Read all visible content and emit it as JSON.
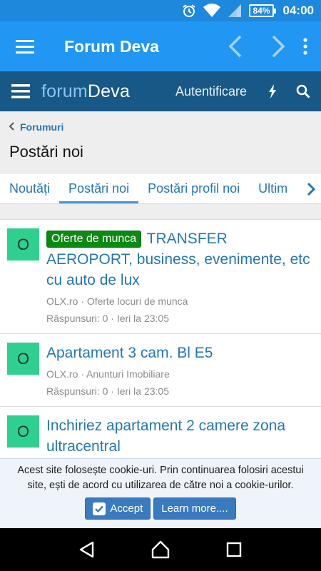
{
  "status_bar": {
    "battery": "84%",
    "time": "04:00"
  },
  "app_bar": {
    "title": "Forum Deva"
  },
  "forum_header": {
    "logo_part1": "forum",
    "logo_part2": "Deva",
    "login": "Autentificare"
  },
  "breadcrumb": {
    "label": "Forumuri"
  },
  "page": {
    "title": "Postări noi"
  },
  "tabs": [
    {
      "label": "Noutăți"
    },
    {
      "label": "Postări noi"
    },
    {
      "label": "Postări profil noi"
    },
    {
      "label": "Ultim"
    }
  ],
  "threads": [
    {
      "avatar": "O",
      "prefix": "Oferte de munca",
      "title": "TRANSFER AEROPORT, business, evenimente, etc cu auto de lux",
      "author": "OLX.ro",
      "forum": "Oferte locuri de munca",
      "replies": "Răspunsuri: 0",
      "date": "Ieri la 23:05"
    },
    {
      "avatar": "O",
      "title": "Apartament 3 cam. Bl E5",
      "author": "OLX.ro",
      "forum": "Anunturi Imobiliare",
      "replies": "Răspunsuri: 0",
      "date": "Ieri la 23:05"
    },
    {
      "avatar": "O",
      "title": "Inchiriez apartament 2 camere zona ultracentral"
    }
  ],
  "cookie": {
    "text": "Acest site folosește cookie-uri. Prin continuarea folosiri acestui site, ești de acord cu utilizarea de către noi a cookie-urilor.",
    "accept": "Accept",
    "learn_more": "Learn more...."
  },
  "colors": {
    "status_bar": "#1d88dc",
    "app_bar": "#2196f3",
    "forum_header": "#185886",
    "link": "#2577b1",
    "avatar": "#2fcf8f",
    "prefix": "#0b8a12"
  }
}
